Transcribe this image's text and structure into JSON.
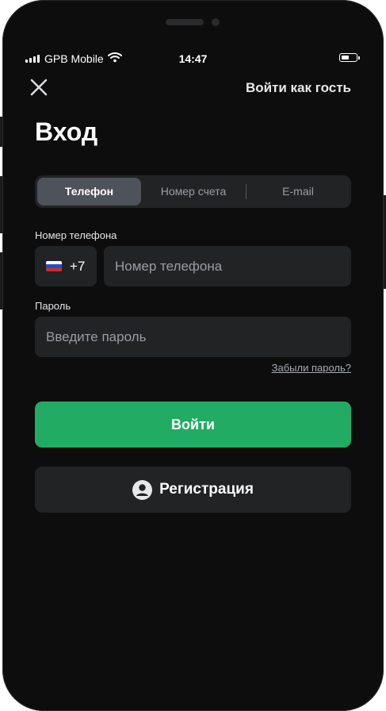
{
  "status_bar": {
    "carrier": "GPB Mobile",
    "time": "14:47"
  },
  "header": {
    "guest_label": "Войти как гость"
  },
  "page": {
    "title": "Вход"
  },
  "tabs": [
    {
      "label": "Телефон",
      "active": true
    },
    {
      "label": "Номер счета",
      "active": false
    },
    {
      "label": "E-mail",
      "active": false
    }
  ],
  "form": {
    "phone_label": "Номер телефона",
    "country_code": "+7",
    "phone_placeholder": "Номер телефона",
    "password_label": "Пароль",
    "password_placeholder": "Введите пароль",
    "forgot_label": "Забыли пароль?"
  },
  "buttons": {
    "login": "Войти",
    "register": "Регистрация"
  },
  "icons": {
    "close": "close-icon",
    "flag": "russia-flag-icon",
    "user": "user-circle-icon",
    "signal": "signal-icon",
    "wifi": "wifi-icon",
    "battery": "battery-icon"
  },
  "colors": {
    "background": "#0d0d0e",
    "surface": "#222325",
    "active_tab": "#4d525b",
    "accent": "#22ab62",
    "muted_text": "#9a9da3"
  }
}
